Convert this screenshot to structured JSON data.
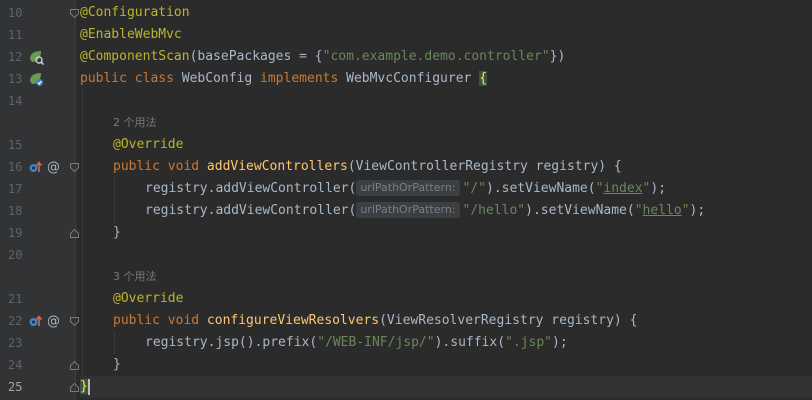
{
  "editor": {
    "colors": {
      "background": "#2b2b2b",
      "gutter": "#313335",
      "annotation": "#bbb529",
      "keyword": "#cc7832",
      "string": "#6a8759",
      "method": "#ffc66d",
      "text": "#a9b7c6"
    },
    "line_numbers": [
      "10",
      "11",
      "12",
      "13",
      "14",
      "15",
      "16",
      "17",
      "18",
      "19",
      "20",
      "21",
      "22",
      "23",
      "24",
      "25"
    ],
    "current_line": "25",
    "gutter_icons": [
      {
        "line": "12",
        "icon": "spring-bean-search-icon"
      },
      {
        "line": "13",
        "icon": "spring-bean-implements-icon"
      },
      {
        "line": "16",
        "icon": "override-method-icon"
      },
      {
        "line": "16",
        "icon": "annotation-at-icon"
      },
      {
        "line": "22",
        "icon": "override-method-icon"
      },
      {
        "line": "22",
        "icon": "annotation-at-icon"
      }
    ],
    "code": {
      "l10": {
        "annotation": "@Configuration"
      },
      "l11": {
        "annotation": "@EnableWebMvc"
      },
      "l12": {
        "annotation": "@ComponentScan",
        "t1": "(basePackages = {",
        "str": "\"com.example.demo.controller\"",
        "t2": "})"
      },
      "l13": {
        "kw1": "public class ",
        "name": "WebConfig ",
        "kw2": "implements ",
        "iface": "WebMvcConfigurer ",
        "brace": "{"
      },
      "usage1": "2 个用法",
      "l15": {
        "annotation": "@Override"
      },
      "l16": {
        "kw": "public void ",
        "fn": "addViewControllers",
        "t": "(ViewControllerRegistry registry) {"
      },
      "l17": {
        "t1": "registry.addViewController(",
        "hint": "urlPathOrPattern:",
        "str1": "\"/\"",
        "t2": ").setViewName(",
        "q1": "\"",
        "u": "index",
        "q2": "\"",
        "t3": ");"
      },
      "l18": {
        "t1": "registry.addViewController(",
        "hint": "urlPathOrPattern:",
        "str1": "\"/hello\"",
        "t2": ").setViewName(",
        "q1": "\"",
        "u": "hello",
        "q2": "\"",
        "t3": ");"
      },
      "l19": {
        "t": "}"
      },
      "usage2": "3 个用法",
      "l21": {
        "annotation": "@Override"
      },
      "l22": {
        "kw": "public void ",
        "fn": "configureViewResolvers",
        "t": "(ViewResolverRegistry registry) {"
      },
      "l23": {
        "t1": "registry.jsp().prefix(",
        "str1": "\"/WEB-INF/jsp/\"",
        "t2": ").suffix(",
        "str2": "\".jsp\"",
        "t3": ");"
      },
      "l24": {
        "t": "}"
      },
      "l25": {
        "brace": "}"
      }
    }
  }
}
